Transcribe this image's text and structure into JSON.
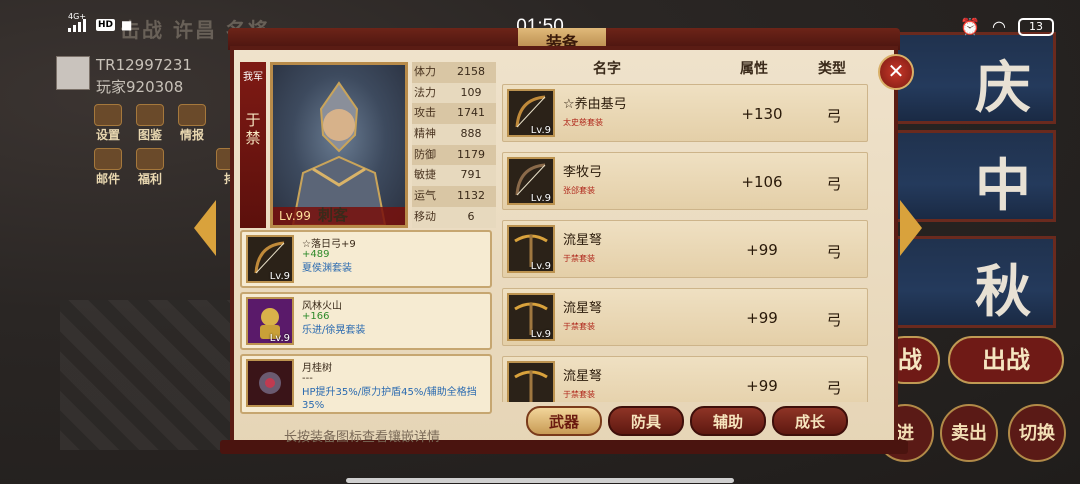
{
  "status_bar": {
    "time": "01:50",
    "network": "4G+",
    "hd": "HD",
    "battery": "13"
  },
  "background": {
    "title": "击战 许昌 名将",
    "player_id": "TR12997231",
    "player_name": "玩家920308",
    "menu": [
      "设置",
      "图鉴",
      "情报",
      "邮件",
      "福利",
      "排"
    ],
    "right_panels": [
      "庆",
      "中",
      "秋"
    ],
    "bottom_buttons": [
      "战",
      "出战"
    ],
    "round_buttons": [
      "进",
      "卖出",
      "切换"
    ]
  },
  "dialog": {
    "title": "装备",
    "close_icon": "close-icon",
    "hero": {
      "faction_tag": "我军",
      "name": "于禁",
      "level": "Lv.99",
      "job": "刺客",
      "stats": [
        {
          "k": "体力",
          "v": "2158"
        },
        {
          "k": "法力",
          "v": "109"
        },
        {
          "k": "攻击",
          "v": "1741"
        },
        {
          "k": "精神",
          "v": "888"
        },
        {
          "k": "防御",
          "v": "1179"
        },
        {
          "k": "敏捷",
          "v": "791"
        },
        {
          "k": "运气",
          "v": "1132"
        },
        {
          "k": "移动",
          "v": "6"
        }
      ]
    },
    "equipped": [
      {
        "name": "☆落日弓+9",
        "bonus": "+489",
        "set": "夏侯渊套装",
        "lv": "Lv.9",
        "icon": "bow-icon"
      },
      {
        "name": "风林火山",
        "bonus": "+166",
        "set": "乐进/徐晃套装",
        "lv": "Lv.9",
        "icon": "armor-icon"
      },
      {
        "name": "月桂树",
        "bonus": "---",
        "set": "HP提升35%/原力护盾45%/辅助全格挡35%",
        "lv": "",
        "icon": "laurel-icon"
      }
    ],
    "hint": "长按装备图标查看镶嵌详情",
    "list_headers": {
      "name": "名字",
      "attr": "属性",
      "type": "类型"
    },
    "items": [
      {
        "name": "☆养由基弓",
        "set": "太史慈套装",
        "attr": "+130",
        "type": "弓",
        "lv": "Lv.9"
      },
      {
        "name": "李牧弓",
        "set": "张郃套装",
        "attr": "+106",
        "type": "弓",
        "lv": "Lv.9"
      },
      {
        "name": "流星弩",
        "set": "于禁套装",
        "attr": "+99",
        "type": "弓",
        "lv": "Lv.9"
      },
      {
        "name": "流星弩",
        "set": "于禁套装",
        "attr": "+99",
        "type": "弓",
        "lv": "Lv.9"
      },
      {
        "name": "流星弩",
        "set": "于禁套装",
        "attr": "+99",
        "type": "弓",
        "lv": ""
      }
    ],
    "tabs": [
      {
        "label": "武器",
        "active": true
      },
      {
        "label": "防具",
        "active": false
      },
      {
        "label": "辅助",
        "active": false
      },
      {
        "label": "成长",
        "active": false
      }
    ]
  }
}
